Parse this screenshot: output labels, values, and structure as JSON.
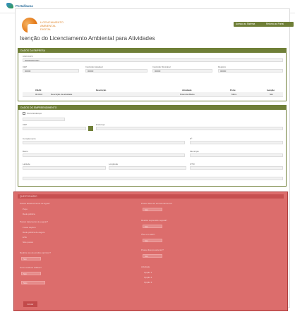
{
  "header": {
    "brand": "Portalfauna",
    "logo_title": "LICENCIAMENTO AMBIENTAL",
    "logo_subtitle": "DIGITAL",
    "buttons": [
      "Acesso ao Sistema",
      "Retorno ao Portal"
    ]
  },
  "page_title": "Isenção do Licenciamento Ambiental para Atividades",
  "company": {
    "header": "DADOS DA EMPRESA",
    "fields": [
      {
        "label": "CNPJ/CPF",
        "value": "00000000/0001"
      },
      {
        "label": "CEP",
        "value": "00000"
      },
      {
        "label": "Inscrição Estadual",
        "value": "00000"
      },
      {
        "label": "Inscrição Municipal",
        "value": "00000"
      },
      {
        "label": "Registro",
        "value": "00000"
      }
    ],
    "table": {
      "headers": [
        "CNAE",
        "Descrição",
        "Atividade",
        "Porte",
        "Isenção"
      ],
      "row": [
        "00.00-0",
        "Descrição da atividade",
        "Potencial Baixo",
        "Micro",
        "Sim"
      ]
    }
  },
  "location": {
    "header": "DADOS DO EMPREENDIMENTO",
    "checkbox_label": "Outro Endereço",
    "fields": [
      {
        "label": "CEP",
        "value": ""
      },
      {
        "label": "Endereço",
        "value": ""
      },
      {
        "label": "Complemento",
        "value": ""
      },
      {
        "label": "Nº",
        "value": ""
      },
      {
        "label": "Bairro",
        "value": ""
      },
      {
        "label": "Município",
        "value": ""
      },
      {
        "label": "Latitude",
        "value": ""
      },
      {
        "label": "Longitude",
        "value": ""
      },
      {
        "label": "UTM",
        "value": ""
      }
    ]
  },
  "questions": {
    "header": "QUESTIONÁRIO",
    "left": [
      {
        "q": "Possui abastecimento de água?",
        "options": [
          "Poço",
          "Rede pública"
        ]
      },
      {
        "q": "Possui tratamento de esgoto?",
        "options": [
          "Fossa séptica",
          "Rede pública de esgoto",
          "ETE",
          "Não possui"
        ]
      },
      {
        "q": "Realiza uso de produto químico?",
        "options": [
          "Sim",
          "Não"
        ]
      },
      {
        "q": "Gera resíduos sólidos?",
        "options": [
          "Sim",
          "Não"
        ]
      }
    ],
    "right": [
      {
        "q": "Possui área de armazenamento?",
        "options": [
          "Sim",
          "Não"
        ]
      },
      {
        "q": "Realiza supressão vegetal?",
        "options": [
          "Sim",
          "Não"
        ]
      },
      {
        "q": "Área em APP?",
        "options": [
          "Sim",
          "Não"
        ]
      },
      {
        "q": "Possui licença anterior?",
        "options": [
          "Sim",
          "Não"
        ]
      },
      {
        "q": "Atividade",
        "options": [
          "Opção 1",
          "Opção 2",
          "Opção 3"
        ]
      }
    ],
    "submit": "Enviar"
  }
}
